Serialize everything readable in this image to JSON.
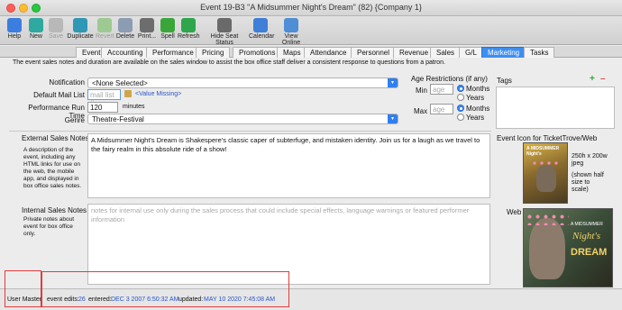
{
  "window": {
    "title": "Event 19-B3 \"A Midsummer Night's Dream\" (82) {Company 1}"
  },
  "toolbar": [
    {
      "label": "Help",
      "icon": "help-icon",
      "color": "#3b7ee0",
      "enabled": true
    },
    {
      "label": "New",
      "icon": "new-icon",
      "color": "#2ea9a0",
      "enabled": true
    },
    {
      "label": "Save",
      "icon": "save-icon",
      "color": "#b8b8b8",
      "enabled": false
    },
    {
      "label": "Duplicate",
      "icon": "duplicate-icon",
      "color": "#2f98b5",
      "enabled": true
    },
    {
      "label": "Revert",
      "icon": "revert-icon",
      "color": "#9ec993",
      "enabled": false
    },
    {
      "label": "Delete",
      "icon": "delete-icon",
      "color": "#8c9db3",
      "enabled": true
    },
    {
      "label": "Print...",
      "icon": "print-icon",
      "color": "#6d6d6d",
      "enabled": true
    },
    {
      "label": "Spell",
      "icon": "spell-icon",
      "color": "#3aa63a",
      "enabled": true
    },
    {
      "label": "Refresh",
      "icon": "refresh-icon",
      "color": "#2ea64b",
      "enabled": true
    },
    {
      "label": "Hide Seat Status",
      "icon": "seat-status-icon",
      "color": "#6a6a6a",
      "enabled": true
    },
    {
      "label": "Calendar",
      "icon": "calendar-icon",
      "color": "#3e7fd8",
      "enabled": true
    },
    {
      "label": "View Online",
      "icon": "view-online-icon",
      "color": "#4d8ed4",
      "enabled": true
    }
  ],
  "tabs": [
    "Event",
    "Accounting",
    "Performance",
    "Pricing",
    "Promotions",
    "Maps",
    "Attendance",
    "Personnel",
    "Revenue",
    "Sales",
    "G/L",
    "Marketing",
    "Tasks"
  ],
  "active_tab": "Marketing",
  "info_line": "The event sales notes and duration are available on the sales window to assist the box office staff deliver a consistent response to questions from a patron.",
  "form": {
    "notification_label": "Notification",
    "notification_value": "<None Selected>",
    "default_mail_list_label": "Default Mail List",
    "mail_list_placeholder": "mail list #",
    "value_missing": "<Value Missing>",
    "run_time_label": "Performance Run Time",
    "run_time_value": "120",
    "run_time_unit": "minutes",
    "genre_label": "Genre",
    "genre_value": "Theatre-Festival"
  },
  "age": {
    "title": "Age Restrictions (if any)",
    "min_label": "Min",
    "max_label": "Max",
    "placeholder": "age",
    "months": "Months",
    "years": "Years"
  },
  "tags": {
    "title": "Tags"
  },
  "external": {
    "label": "External Sales Notes",
    "description": "A description of the event, including any HTML links for use on the web, the mobile app, and displayed in box office sales notes.",
    "text": "A Midsummer Night's Dream is Shakespere's classic caper of subterfuge, and mistaken identity. Join us for a laugh as we travel to the fairy realm in this absolute ride of a show!"
  },
  "internal": {
    "label": "Internal Sales Notes",
    "description": "Private notes about event for box office only.",
    "placeholder": "notes for internal use only during the sales process that could include special effects, language warnings or featured performer information"
  },
  "event_icon": {
    "title": "Event Icon for TicketTrove/Web",
    "size_note": "250h x 200w jpeg",
    "scale_note": "(shown half size to scale)",
    "web_label": "Web",
    "poster_line1": "A MIDSUMMER",
    "poster_line2": "Night's",
    "poster_line3": "DREAM"
  },
  "status": {
    "user": "User Master",
    "edits_label": "event edits:",
    "edits_value": "26",
    "entered_label": "entered:",
    "entered_value": "DEC 3 2007 6:50:32 AM",
    "updated_label": "updated:",
    "updated_value": "MAY 10 2020 7:45:08 AM"
  },
  "colors": {
    "accent": "#3d8ef0",
    "highlight_box": "#e03b3b",
    "link": "#2a55c9"
  }
}
